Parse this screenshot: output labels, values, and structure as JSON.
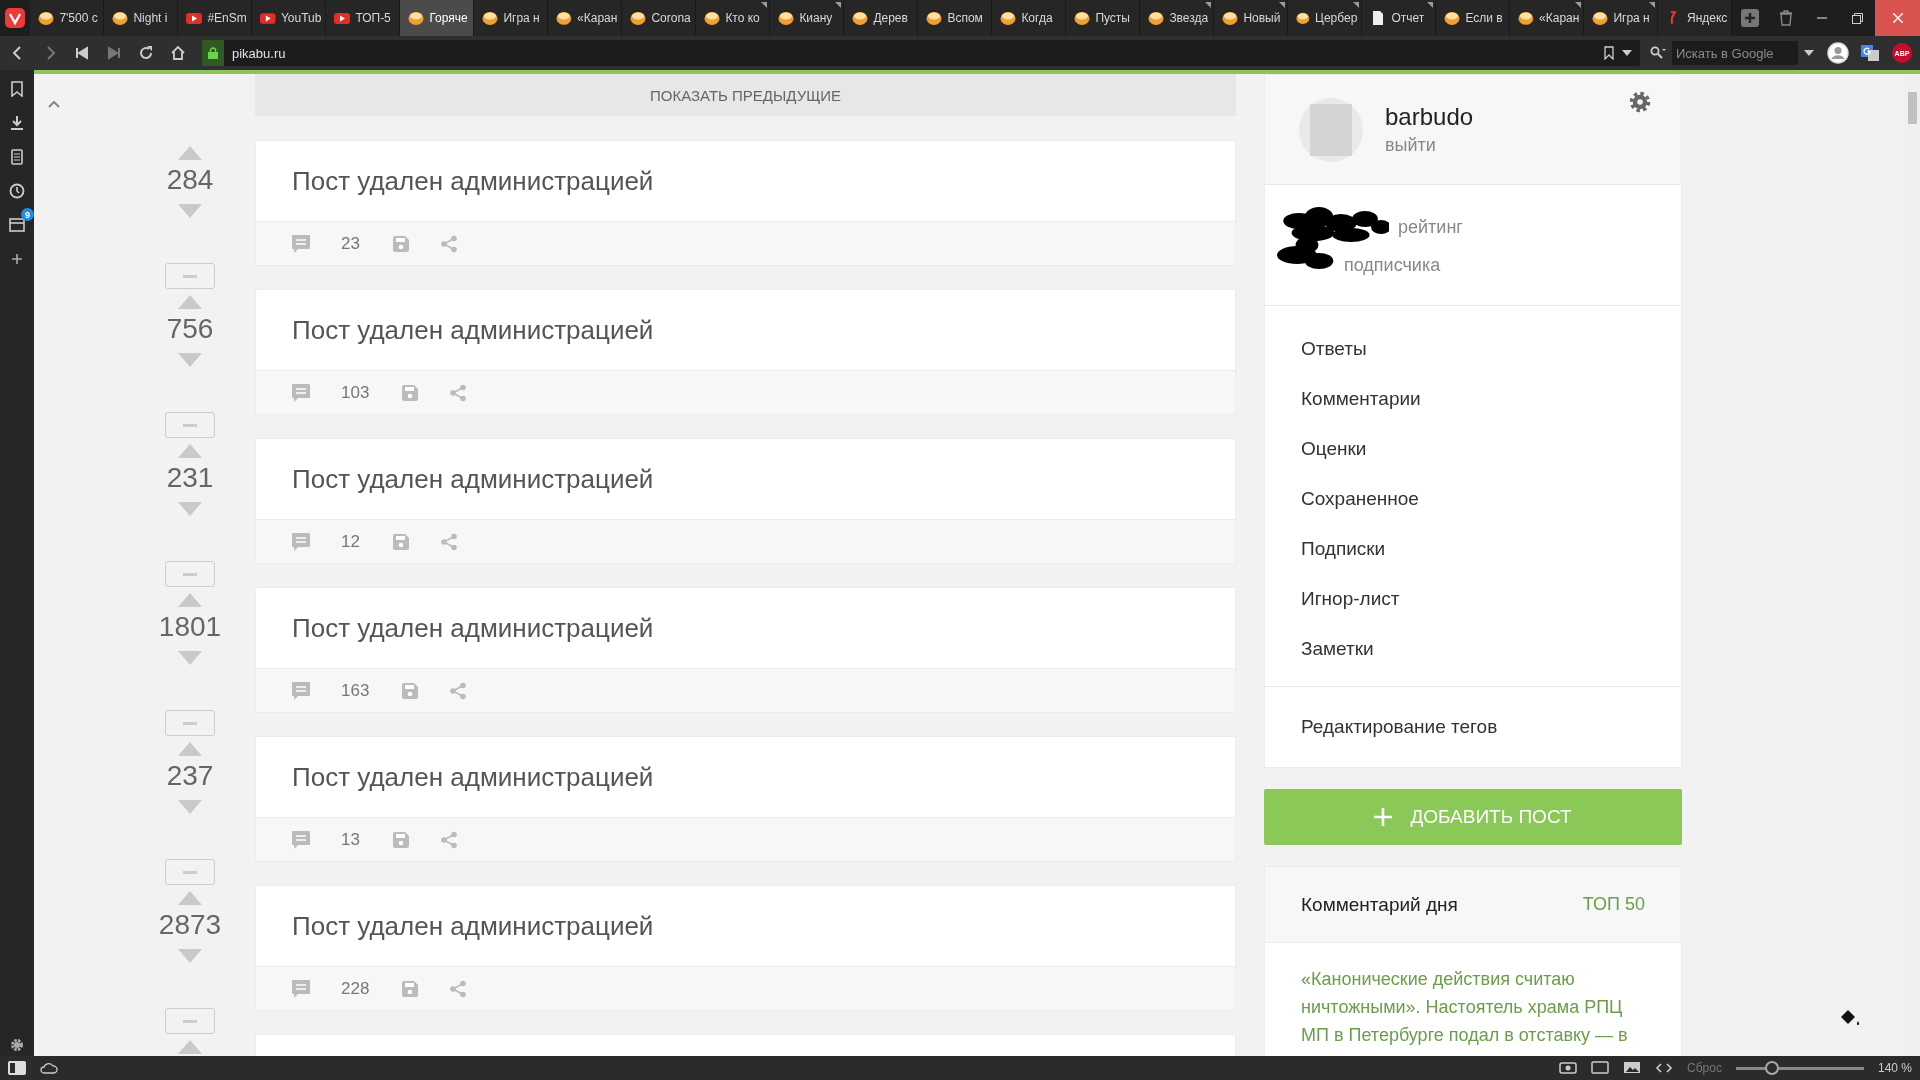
{
  "browser": {
    "tabs": [
      {
        "title": "7'500 с",
        "kind": "pikabu",
        "selected": false,
        "marked": false
      },
      {
        "title": "Night i",
        "kind": "pikabu",
        "selected": false,
        "marked": false
      },
      {
        "title": "#EnSm",
        "kind": "youtube",
        "selected": false,
        "marked": false
      },
      {
        "title": "YouTub",
        "kind": "youtube",
        "selected": false,
        "marked": false
      },
      {
        "title": "ТОП-5",
        "kind": "youtube",
        "selected": false,
        "marked": false
      },
      {
        "title": "Горяче",
        "kind": "pikabu",
        "selected": true,
        "marked": false
      },
      {
        "title": "Игра н",
        "kind": "pikabu",
        "selected": false,
        "marked": false
      },
      {
        "title": "«Каран",
        "kind": "pikabu",
        "selected": false,
        "marked": false
      },
      {
        "title": "Corona",
        "kind": "pikabu",
        "selected": false,
        "marked": false
      },
      {
        "title": "Кто ко",
        "kind": "pikabu",
        "selected": false,
        "marked": true
      },
      {
        "title": "Киану",
        "kind": "pikabu",
        "selected": false,
        "marked": true
      },
      {
        "title": "Дерев",
        "kind": "pikabu",
        "selected": false,
        "marked": false
      },
      {
        "title": "Вспом",
        "kind": "pikabu",
        "selected": false,
        "marked": false
      },
      {
        "title": "Когда",
        "kind": "pikabu",
        "selected": false,
        "marked": false
      },
      {
        "title": "Пусты",
        "kind": "pikabu",
        "selected": false,
        "marked": false
      },
      {
        "title": "Звезда",
        "kind": "pikabu",
        "selected": false,
        "marked": true
      },
      {
        "title": "Новый",
        "kind": "pikabu",
        "selected": false,
        "marked": true
      },
      {
        "title": "Цербер",
        "kind": "pikabu",
        "selected": false,
        "marked": true
      },
      {
        "title": "Отчет",
        "kind": "page",
        "selected": false,
        "marked": true
      },
      {
        "title": "Если в",
        "kind": "pikabu",
        "selected": false,
        "marked": false
      },
      {
        "title": "«Каран",
        "kind": "pikabu",
        "selected": false,
        "marked": true
      },
      {
        "title": "Игра н",
        "kind": "pikabu",
        "selected": false,
        "marked": true
      },
      {
        "title": "Яндекс",
        "kind": "yandex",
        "selected": false,
        "marked": false
      }
    ],
    "address": {
      "url": "pikabu.ru"
    },
    "search": {
      "placeholder": "Искать в Google"
    },
    "abp_label": "ABP"
  },
  "panel": {
    "badge": "9"
  },
  "page": {
    "show_previous": "ПОКАЗАТЬ ПРЕДЫДУЩИЕ",
    "posts": [
      {
        "votes": "284",
        "title": "Пост удален администрацией",
        "comments": "23"
      },
      {
        "votes": "756",
        "title": "Пост удален администрацией",
        "comments": "103"
      },
      {
        "votes": "231",
        "title": "Пост удален администрацией",
        "comments": "12"
      },
      {
        "votes": "1801",
        "title": "Пост удален администрацией",
        "comments": "163"
      },
      {
        "votes": "237",
        "title": "Пост удален администрацией",
        "comments": "13"
      },
      {
        "votes": "2873",
        "title": "Пост удален администрацией",
        "comments": "228"
      }
    ],
    "profile": {
      "username": "barbudo",
      "logout": "выйти",
      "rating_label": "рейтинг",
      "subscribers_label": "подписчика"
    },
    "menu": [
      "Ответы",
      "Комментарии",
      "Оценки",
      "Сохраненное",
      "Подписки",
      "Игнор-лист",
      "Заметки"
    ],
    "edit_tags": "Редактирование тегов",
    "add_post": "ДОБАВИТЬ ПОСТ",
    "comment_of_day": {
      "title": "Комментарий дня",
      "link": "ТОП 50",
      "text": "«Канонические действия считаю ничтожными». Настоятель храма РПЦ МП в Петербурге подал в отставку — в"
    }
  },
  "status_bar": {
    "reset": "Сброс",
    "zoom": {
      "level": 0.28
    },
    "zoom_reading": "140 %"
  }
}
